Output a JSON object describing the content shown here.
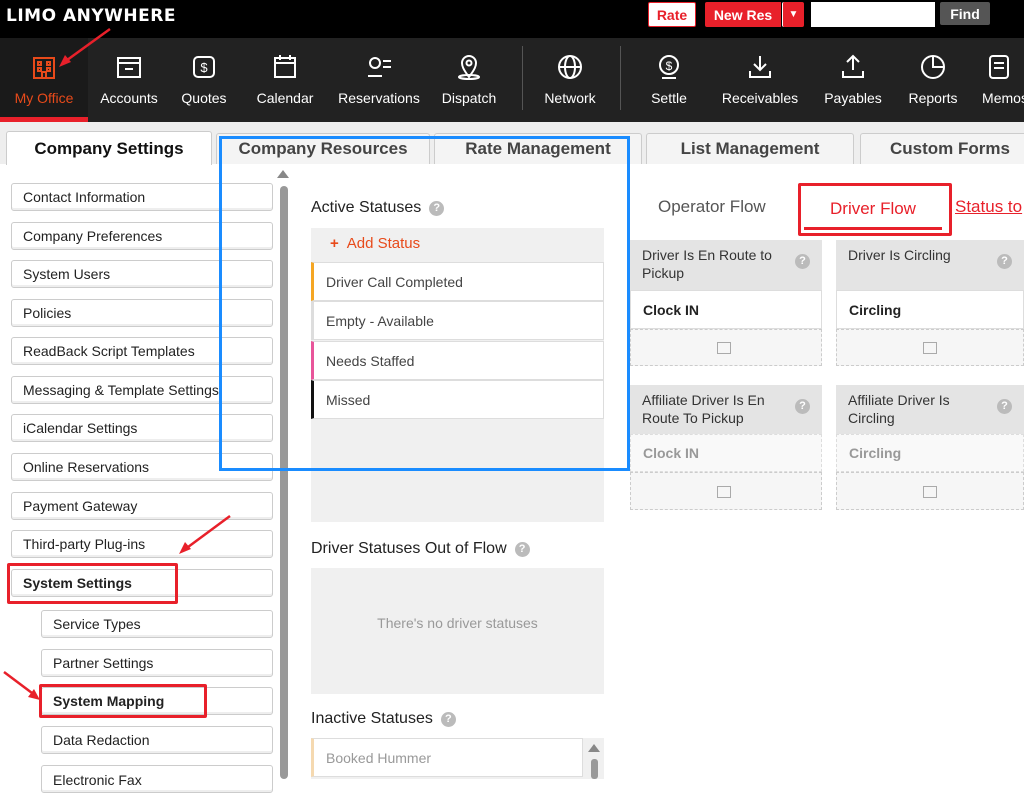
{
  "app": {
    "logo": "LIMO ANYWHERE"
  },
  "topbar": {
    "rate": "Rate",
    "new_res": "New Res",
    "find": "Find",
    "search_placeholder": ""
  },
  "nav": [
    {
      "label": "My Office"
    },
    {
      "label": "Accounts"
    },
    {
      "label": "Quotes"
    },
    {
      "label": "Calendar"
    },
    {
      "label": "Reservations"
    },
    {
      "label": "Dispatch"
    },
    {
      "label": "Network"
    },
    {
      "label": "Settle"
    },
    {
      "label": "Receivables"
    },
    {
      "label": "Payables"
    },
    {
      "label": "Reports"
    },
    {
      "label": "Memos"
    }
  ],
  "tabs": [
    {
      "label": "Company Settings"
    },
    {
      "label": "Company Resources"
    },
    {
      "label": "Rate Management"
    },
    {
      "label": "List Management"
    },
    {
      "label": "Custom Forms"
    }
  ],
  "sidebar": [
    {
      "label": "Contact Information"
    },
    {
      "label": "Company Preferences"
    },
    {
      "label": "System Users"
    },
    {
      "label": "Policies"
    },
    {
      "label": "ReadBack Script Templates"
    },
    {
      "label": "Messaging & Template Settings"
    },
    {
      "label": "iCalendar Settings"
    },
    {
      "label": "Online Reservations"
    },
    {
      "label": "Payment Gateway"
    },
    {
      "label": "Third-party Plug-ins"
    },
    {
      "label": "System Settings"
    },
    {
      "label": "Service Types"
    },
    {
      "label": "Partner Settings"
    },
    {
      "label": "System Mapping"
    },
    {
      "label": "Data Redaction"
    },
    {
      "label": "Electronic Fax"
    }
  ],
  "statuses": {
    "active_title": "Active Statuses",
    "add_status": "Add Status",
    "active": [
      {
        "label": "Driver Call Completed",
        "color": "#f5a623"
      },
      {
        "label": "Empty - Available",
        "color": "#dddddd"
      },
      {
        "label": "Needs Staffed",
        "color": "#e8559a"
      },
      {
        "label": "Missed",
        "color": "#111111"
      }
    ],
    "out_title": "Driver Statuses Out of Flow",
    "out_empty": "There's no driver statuses",
    "inactive_title": "Inactive Statuses",
    "inactive": [
      {
        "label": "Booked Hummer"
      }
    ]
  },
  "flow": {
    "tabs": {
      "operator": "Operator Flow",
      "driver": "Driver Flow",
      "status_to": "Status to"
    },
    "cards": [
      {
        "title": "Driver Is En Route to Pickup",
        "status": "Clock IN"
      },
      {
        "title": "Driver Is Circling",
        "status": "Circling"
      },
      {
        "title": "Affiliate Driver Is En Route To Pickup",
        "status": "Clock IN"
      },
      {
        "title": "Affiliate Driver Is Circling",
        "status": "Circling"
      }
    ]
  },
  "help_glyph": "?",
  "colors": {
    "accent": "#e8202a",
    "highlight_blue": "#1a8cff"
  }
}
